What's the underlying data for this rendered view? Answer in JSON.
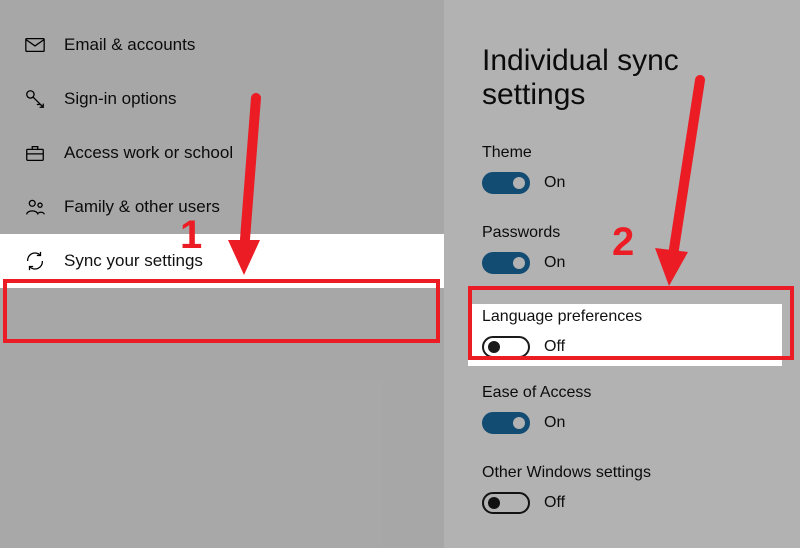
{
  "nav": {
    "items": [
      {
        "id": "email",
        "label": "Email & accounts",
        "icon": "mail"
      },
      {
        "id": "signin",
        "label": "Sign-in options",
        "icon": "key"
      },
      {
        "id": "work",
        "label": "Access work or school",
        "icon": "briefcase"
      },
      {
        "id": "family",
        "label": "Family & other users",
        "icon": "people"
      },
      {
        "id": "sync",
        "label": "Sync your settings",
        "icon": "sync",
        "selected": true
      }
    ]
  },
  "pane": {
    "heading": "Individual sync settings",
    "settings": [
      {
        "id": "theme",
        "label": "Theme",
        "state": "on",
        "state_label": "On"
      },
      {
        "id": "pw",
        "label": "Passwords",
        "state": "on",
        "state_label": "On"
      },
      {
        "id": "lang",
        "label": "Language preferences",
        "state": "off",
        "state_label": "Off"
      },
      {
        "id": "ease",
        "label": "Ease of Access",
        "state": "on",
        "state_label": "On"
      },
      {
        "id": "other",
        "label": "Other Windows settings",
        "state": "off",
        "state_label": "Off"
      }
    ]
  },
  "annotations": {
    "step1": "1",
    "step2": "2",
    "color": "#ec1c24"
  }
}
